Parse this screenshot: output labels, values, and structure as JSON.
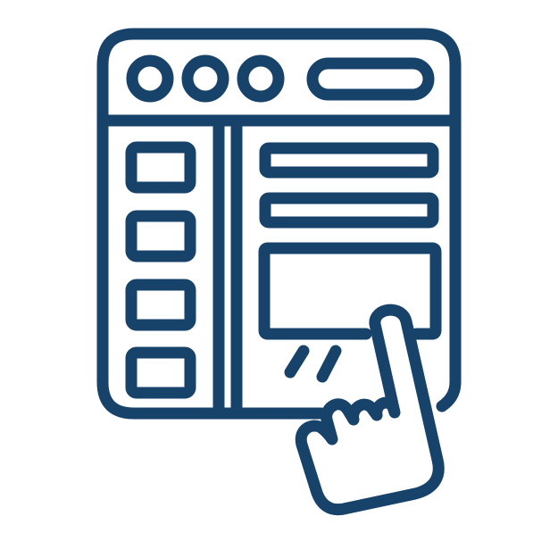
{
  "icon": {
    "name": "web-page-tap-icon",
    "stroke_color": "#17426A",
    "background_color": "#FFFFFF",
    "parts": [
      "browser-window-icon",
      "window-control-dot-icon",
      "address-bar-icon",
      "sidebar-block-icon",
      "content-line-icon",
      "content-panel-icon",
      "tap-indicator-icon",
      "pointing-hand-icon"
    ]
  }
}
